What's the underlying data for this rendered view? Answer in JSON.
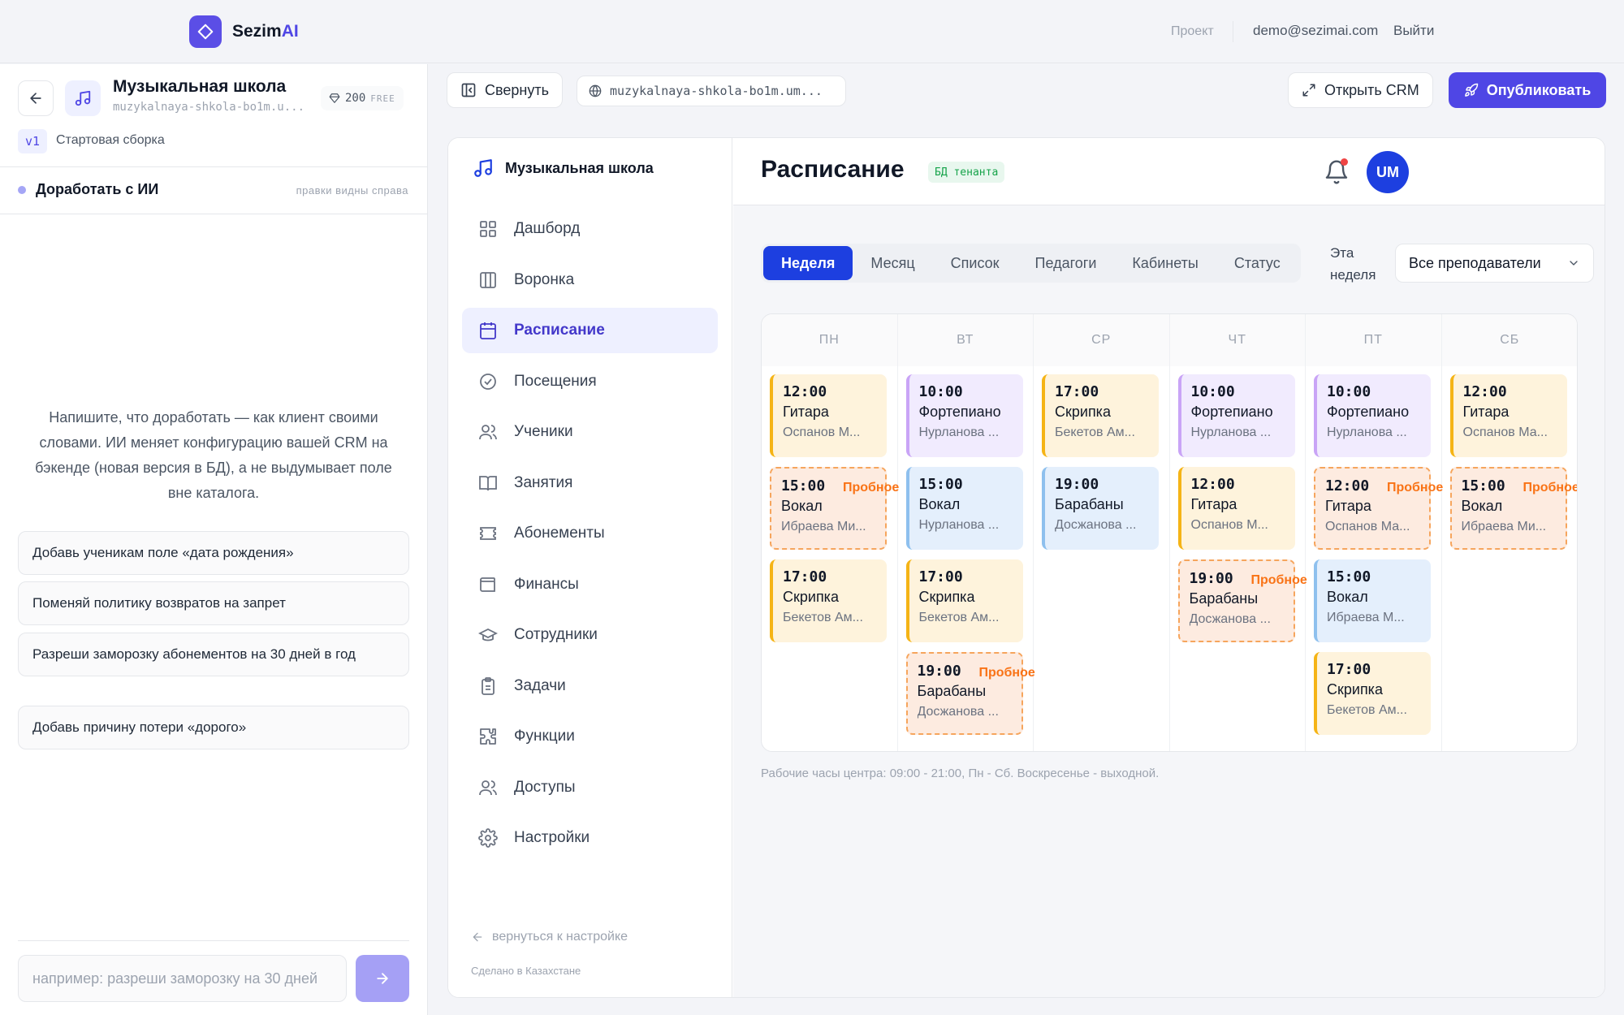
{
  "brand": {
    "name_main": "Sezim",
    "name_accent": "AI",
    "accent_color": "#5b4ee6"
  },
  "topbar": {
    "project": "Проект",
    "email": "demo@sezimai.com",
    "logout": "Выйти"
  },
  "project": {
    "name": "Музыкальная школа",
    "slug": "muzykalnaya-shkola-bo1m.u...",
    "credits": "200",
    "credits_plan": "FREE",
    "version": "v1",
    "version_label": "Стартовая сборка"
  },
  "ai_panel": {
    "title": "Доработать с ИИ",
    "hint": "правки видны справа",
    "intro": "Напишите, что доработать — как клиент своими словами. ИИ меняет конфигурацию вашей CRM на бэкенде (новая версия в БД), а не выдумывает поле вне каталога.",
    "suggestions": [
      "Добавь ученикам поле «дата рождения»",
      "Поменяй политику возвратов на запрет",
      "Разреши заморозку абонементов на 30 дней в год",
      "Добавь причину потери «дорого»"
    ],
    "input_placeholder": "например: разреши заморозку на 30 дней"
  },
  "toolbar": {
    "collapse": "Свернуть",
    "url": "muzykalnaya-shkola-bo1m.um...",
    "open_crm": "Открыть CRM",
    "publish": "Опубликовать"
  },
  "crm": {
    "brand": "Музыкальная школа",
    "nav": [
      {
        "label": "Дашборд",
        "icon": "grid-icon"
      },
      {
        "label": "Воронка",
        "icon": "columns-icon"
      },
      {
        "label": "Расписание",
        "icon": "calendar-icon",
        "active": true
      },
      {
        "label": "Посещения",
        "icon": "check-circle-icon"
      },
      {
        "label": "Ученики",
        "icon": "users-icon"
      },
      {
        "label": "Занятия",
        "icon": "book-icon"
      },
      {
        "label": "Абонементы",
        "icon": "ticket-icon"
      },
      {
        "label": "Финансы",
        "icon": "wallet-icon"
      },
      {
        "label": "Сотрудники",
        "icon": "graduation-cap-icon"
      },
      {
        "label": "Задачи",
        "icon": "clipboard-icon"
      },
      {
        "label": "Функции",
        "icon": "puzzle-icon"
      },
      {
        "label": "Доступы",
        "icon": "users-icon"
      },
      {
        "label": "Настройки",
        "icon": "gear-icon"
      }
    ],
    "back_link": "вернуться к настройке",
    "made_in": "Сделано в Казахстане",
    "page_title": "Расписание",
    "db_badge": "БД тенанта",
    "avatar": "UM",
    "tabs": [
      "Неделя",
      "Месяц",
      "Список",
      "Педагоги",
      "Кабинеты",
      "Статус"
    ],
    "active_tab": "Неделя",
    "week_label": "Эта неделя",
    "teacher_filter": "Все преподаватели",
    "footnote": "Рабочие часы центра: 09:00 - 21:00, Пн - Сб. Воскресенье - выходной.",
    "days": [
      {
        "name": "ПН",
        "events": [
          {
            "time": "12:00",
            "subject": "Гитара",
            "teacher": "Оспанов М...",
            "color": "orange"
          },
          {
            "time": "15:00",
            "subject": "Вокал",
            "teacher": "Ибраева Ми...",
            "color": "trial",
            "trial": "Пробное"
          },
          {
            "time": "17:00",
            "subject": "Скрипка",
            "teacher": "Бекетов Ам...",
            "color": "orange"
          }
        ]
      },
      {
        "name": "ВТ",
        "events": [
          {
            "time": "10:00",
            "subject": "Фортепиано",
            "teacher": "Нурланова ...",
            "color": "purple"
          },
          {
            "time": "15:00",
            "subject": "Вокал",
            "teacher": "Нурланова ...",
            "color": "blue"
          },
          {
            "time": "17:00",
            "subject": "Скрипка",
            "teacher": "Бекетов Ам...",
            "color": "orange"
          },
          {
            "time": "19:00",
            "subject": "Барабаны",
            "teacher": "Досжанова ...",
            "color": "trial",
            "trial": "Пробное"
          }
        ]
      },
      {
        "name": "СР",
        "events": [
          {
            "time": "17:00",
            "subject": "Скрипка",
            "teacher": "Бекетов Ам...",
            "color": "orange"
          },
          {
            "time": "19:00",
            "subject": "Барабаны",
            "teacher": "Досжанова ...",
            "color": "blue"
          }
        ]
      },
      {
        "name": "ЧТ",
        "events": [
          {
            "time": "10:00",
            "subject": "Фортепиано",
            "teacher": "Нурланова ...",
            "color": "purple"
          },
          {
            "time": "12:00",
            "subject": "Гитара",
            "teacher": "Оспанов М...",
            "color": "orange"
          },
          {
            "time": "19:00",
            "subject": "Барабаны",
            "teacher": "Досжанова ...",
            "color": "trial",
            "trial": "Пробное"
          }
        ]
      },
      {
        "name": "ПТ",
        "events": [
          {
            "time": "10:00",
            "subject": "Фортепиано",
            "teacher": "Нурланова ...",
            "color": "purple"
          },
          {
            "time": "12:00",
            "subject": "Гитара",
            "teacher": "Оспанов Ма...",
            "color": "trial",
            "trial": "Пробное"
          },
          {
            "time": "15:00",
            "subject": "Вокал",
            "teacher": "Ибраева М...",
            "color": "blue"
          },
          {
            "time": "17:00",
            "subject": "Скрипка",
            "teacher": "Бекетов Ам...",
            "color": "orange"
          }
        ]
      },
      {
        "name": "СБ",
        "events": [
          {
            "time": "12:00",
            "subject": "Гитара",
            "teacher": "Оспанов Ма...",
            "color": "orange"
          },
          {
            "time": "15:00",
            "subject": "Вокал",
            "teacher": "Ибраева Ми...",
            "color": "trial",
            "trial": "Пробное"
          }
        ]
      }
    ]
  }
}
